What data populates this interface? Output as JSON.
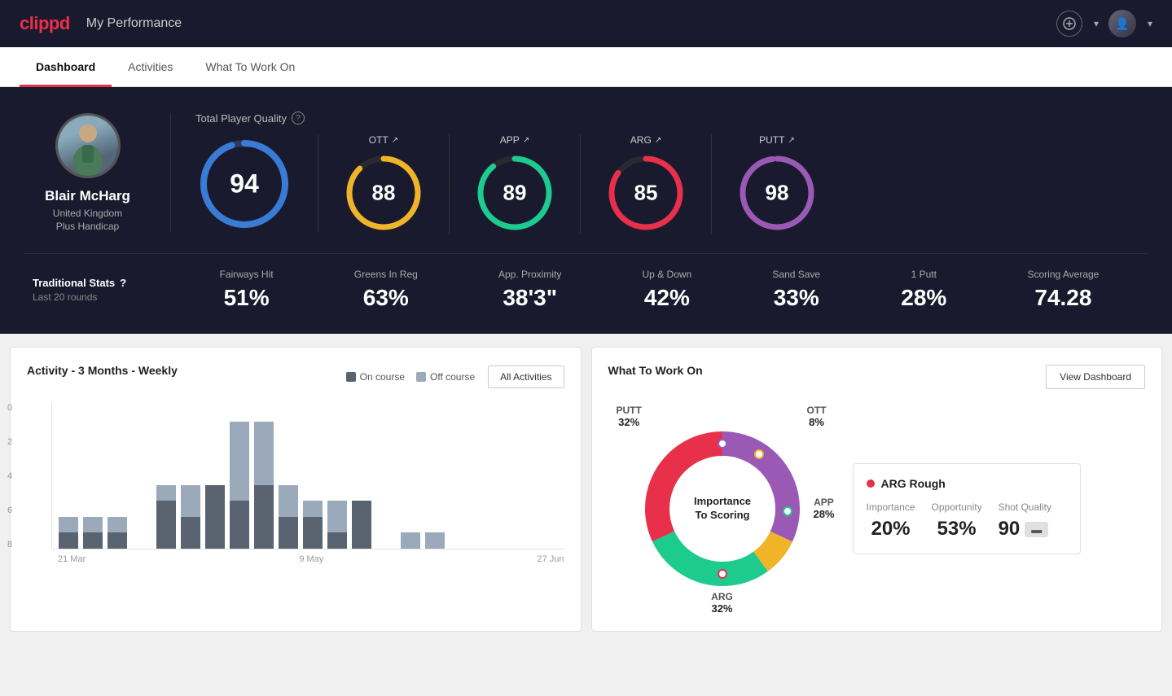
{
  "app": {
    "logo": "clippd",
    "title": "My Performance"
  },
  "tabs": [
    {
      "id": "dashboard",
      "label": "Dashboard",
      "active": true
    },
    {
      "id": "activities",
      "label": "Activities",
      "active": false
    },
    {
      "id": "what-to-work-on",
      "label": "What To Work On",
      "active": false
    }
  ],
  "player": {
    "name": "Blair McHarg",
    "country": "United Kingdom",
    "handicap": "Plus Handicap"
  },
  "quality": {
    "label": "Total Player Quality",
    "total": {
      "value": 94,
      "color": "#3a7bd5",
      "trail": "#2a3a5e"
    },
    "ott": {
      "label": "OTT",
      "value": 88,
      "color": "#f0b429",
      "trail": "#2a2a2e"
    },
    "app": {
      "label": "APP",
      "value": 89,
      "color": "#1ecb8e",
      "trail": "#2a2a2e"
    },
    "arg": {
      "label": "ARG",
      "value": 85,
      "color": "#e8304a",
      "trail": "#2a2a2e"
    },
    "putt": {
      "label": "PUTT",
      "value": 98,
      "color": "#9b59b6",
      "trail": "#2a2a2e"
    }
  },
  "traditional_stats": {
    "title": "Traditional Stats",
    "subtitle": "Last 20 rounds",
    "stats": [
      {
        "name": "Fairways Hit",
        "value": "51%"
      },
      {
        "name": "Greens In Reg",
        "value": "63%"
      },
      {
        "name": "App. Proximity",
        "value": "38'3\""
      },
      {
        "name": "Up & Down",
        "value": "42%"
      },
      {
        "name": "Sand Save",
        "value": "33%"
      },
      {
        "name": "1 Putt",
        "value": "28%"
      },
      {
        "name": "Scoring Average",
        "value": "74.28"
      }
    ]
  },
  "activity_chart": {
    "title": "Activity - 3 Months - Weekly",
    "legend": [
      {
        "label": "On course",
        "color": "#5a6370"
      },
      {
        "label": "Off course",
        "color": "#9baabb"
      }
    ],
    "button": "All Activities",
    "y_labels": [
      "0",
      "2",
      "4",
      "6",
      "8"
    ],
    "x_labels": [
      "21 Mar",
      "9 May",
      "27 Jun"
    ],
    "bars": [
      {
        "on": 1,
        "off": 1
      },
      {
        "on": 1,
        "off": 1
      },
      {
        "on": 1,
        "off": 1
      },
      {
        "on": 0,
        "off": 0
      },
      {
        "on": 3,
        "off": 1
      },
      {
        "on": 2,
        "off": 2
      },
      {
        "on": 4,
        "off": 0
      },
      {
        "on": 3,
        "off": 5
      },
      {
        "on": 4,
        "off": 4
      },
      {
        "on": 2,
        "off": 2
      },
      {
        "on": 2,
        "off": 1
      },
      {
        "on": 1,
        "off": 2
      },
      {
        "on": 3,
        "off": 0
      },
      {
        "on": 0,
        "off": 0
      },
      {
        "on": 0,
        "off": 1
      },
      {
        "on": 0,
        "off": 1
      }
    ]
  },
  "what_to_work_on": {
    "title": "What To Work On",
    "button": "View Dashboard",
    "donut": {
      "center_line1": "Importance",
      "center_line2": "To Scoring",
      "segments": [
        {
          "label": "OTT",
          "value": "8%",
          "percent": 8,
          "color": "#f0b429"
        },
        {
          "label": "APP",
          "value": "28%",
          "percent": 28,
          "color": "#1ecb8e"
        },
        {
          "label": "ARG",
          "value": "32%",
          "percent": 32,
          "color": "#e8304a"
        },
        {
          "label": "PUTT",
          "value": "32%",
          "percent": 32,
          "color": "#9b59b6"
        }
      ]
    },
    "score_card": {
      "title": "ARG Rough",
      "dot_color": "#e8304a",
      "metrics": [
        {
          "label": "Importance",
          "value": "20%"
        },
        {
          "label": "Opportunity",
          "value": "53%"
        },
        {
          "label": "Shot Quality",
          "value": "90",
          "is_badge": true
        }
      ]
    }
  }
}
